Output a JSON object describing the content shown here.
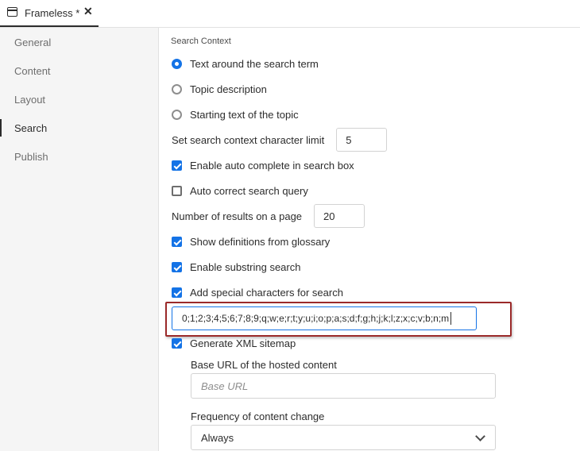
{
  "tab": {
    "title": "Frameless *",
    "close": "✕"
  },
  "sidebar": {
    "items": [
      {
        "label": "General",
        "active": false
      },
      {
        "label": "Content",
        "active": false
      },
      {
        "label": "Layout",
        "active": false
      },
      {
        "label": "Search",
        "active": true
      },
      {
        "label": "Publish",
        "active": false
      }
    ]
  },
  "main": {
    "section_label": "Search Context",
    "radios": [
      {
        "label": "Text around the search term",
        "selected": true
      },
      {
        "label": "Topic description",
        "selected": false
      },
      {
        "label": "Starting text of the topic",
        "selected": false
      }
    ],
    "context_limit": {
      "label": "Set search context character limit",
      "value": "5"
    },
    "autocomplete": {
      "label": "Enable auto complete in search box",
      "checked": true
    },
    "autocorrect": {
      "label": "Auto correct search query",
      "checked": false
    },
    "results_per_page": {
      "label": "Number of results on a page",
      "value": "20"
    },
    "glossary": {
      "label": "Show definitions from glossary",
      "checked": true
    },
    "substring": {
      "label": "Enable substring search",
      "checked": true
    },
    "special_chars": {
      "label": "Add special characters for search",
      "checked": true,
      "value": "0;1;2;3;4;5;6;7;8;9;q;w;e;r;t;y;u;i;o;p;a;s;d;f;g;h;j;k;l;z;x;c;v;b;n;m"
    },
    "sitemap": {
      "label": "Generate XML sitemap",
      "checked": true
    },
    "base_url": {
      "label": "Base URL of the hosted content",
      "placeholder": "Base URL"
    },
    "frequency": {
      "label": "Frequency of content change",
      "value": "Always"
    }
  },
  "colors": {
    "accent": "#1473e6",
    "highlight_border": "#9b2a2a"
  }
}
